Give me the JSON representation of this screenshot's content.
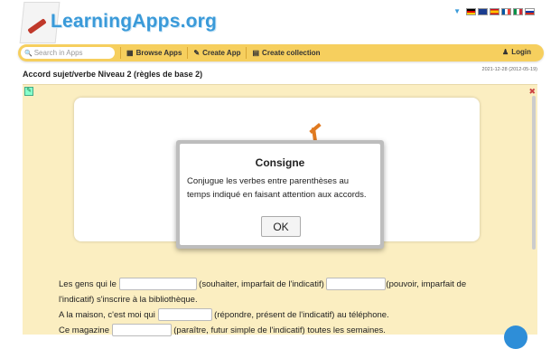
{
  "header": {
    "logo_text": "LearningApps.org"
  },
  "navbar": {
    "search_placeholder": "Search in Apps",
    "browse_label": "Browse Apps",
    "create_label": "Create App",
    "collection_label": "Create collection",
    "login_label": "Login"
  },
  "page": {
    "title": "Accord sujet/verbe Niveau 2 (règles de base 2)",
    "date": "2021-12-28 (2012-05-19)"
  },
  "modal": {
    "title": "Consigne",
    "text": "Conjugue les verbes entre parenthèses au temps indiqué en faisant attention aux accords.",
    "ok_label": "OK"
  },
  "exercise": {
    "s1_a": "Les gens qui le ",
    "s1_b": " (souhaiter, imparfait de l'indicatif) ",
    "s1_c": "(pouvoir, imparfait de l'indicatif) s'inscrire à la bibliothèque.",
    "s2_a": "A la maison, c'est moi qui ",
    "s2_b": " (répondre, présent de l'indicatif) au téléphone.",
    "s3_a": "Ce magazine ",
    "s3_b": " (paraître, futur simple de l'indicatif) toutes les semaines."
  },
  "flags": [
    "de",
    "gb",
    "es",
    "fr",
    "it",
    "ru"
  ]
}
